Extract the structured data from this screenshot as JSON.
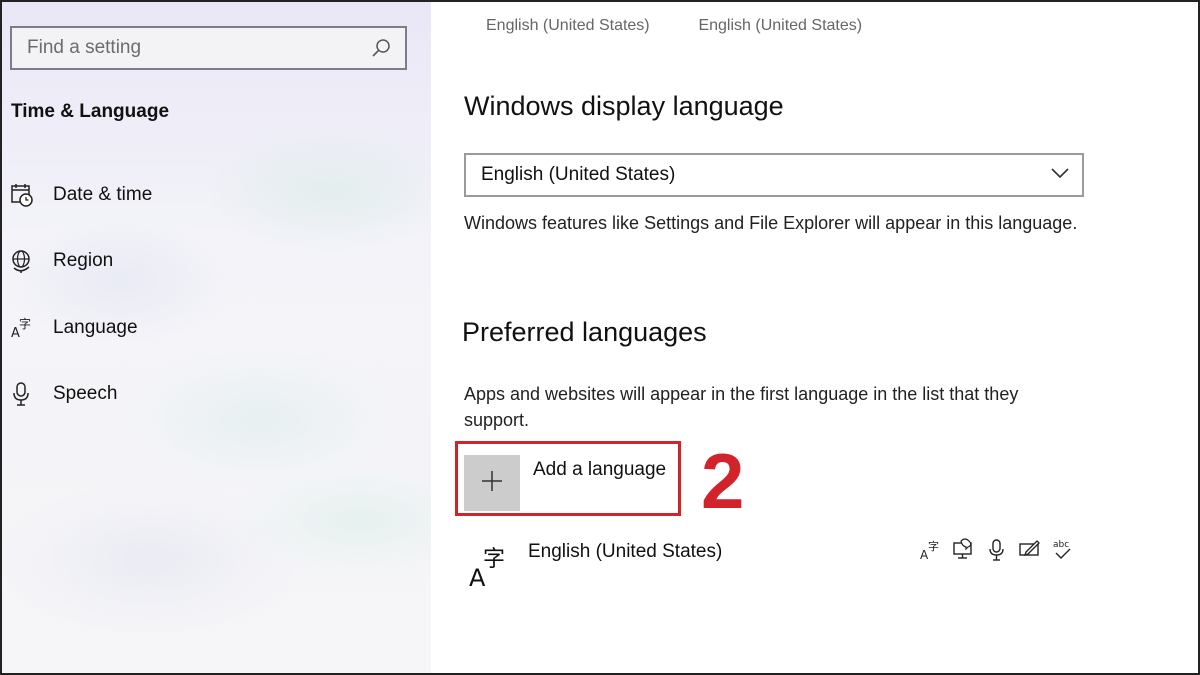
{
  "sidebar": {
    "search": {
      "placeholder": "Find a setting",
      "icon": "search-icon"
    },
    "section_title": "Time & Language",
    "items": [
      {
        "label": "Date & time",
        "icon": "calendar-clock-icon"
      },
      {
        "label": "Region",
        "icon": "globe-icon"
      },
      {
        "label": "Language",
        "icon": "language-icon"
      },
      {
        "label": "Speech",
        "icon": "microphone-icon"
      }
    ]
  },
  "main": {
    "top_labels": [
      "English (United States)",
      "English (United States)"
    ],
    "display_language": {
      "heading": "Windows display language",
      "selected": "English (United States)",
      "description": "Windows features like Settings and File Explorer will appear in this language."
    },
    "preferred": {
      "heading": "Preferred languages",
      "description": "Apps and websites will appear in the first language in the list that they support.",
      "add_label": "Add a language",
      "step_number": "2",
      "languages": [
        {
          "label": "English (United States)",
          "icon": "language-icon",
          "feature_icons": [
            "display-language-icon",
            "text-to-speech-icon",
            "speech-recognition-icon",
            "handwriting-icon",
            "spell-check-icon"
          ]
        }
      ]
    }
  },
  "colors": {
    "highlight": "#d2232a",
    "plus_tile": "#cccccc",
    "sidebar_bg": "#f3f3f9"
  }
}
